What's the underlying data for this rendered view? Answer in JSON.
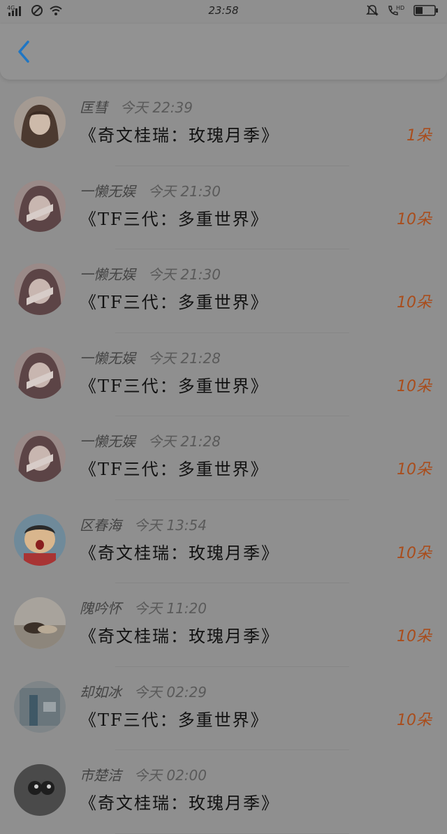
{
  "status_bar": {
    "network": "4G",
    "time": "23:58",
    "icons": [
      "signal-icon",
      "blocked-icon",
      "wifi-icon",
      "mute-icon",
      "hd-call-icon",
      "battery-icon"
    ],
    "hd_label": "HD"
  },
  "header": {
    "back_icon": "chevron-left-icon",
    "accent": "#1f76c4"
  },
  "list": [
    {
      "name": "匡彗",
      "time": "今天 22:39",
      "title": "《奇文桂瑞：玫瑰月季》",
      "count": "1朵"
    },
    {
      "name": "一懒无娱",
      "time": "今天 21:30",
      "title": "《TF三代：多重世界》",
      "count": "10朵"
    },
    {
      "name": "一懒无娱",
      "time": "今天 21:30",
      "title": "《TF三代：多重世界》",
      "count": "10朵"
    },
    {
      "name": "一懒无娱",
      "time": "今天 21:28",
      "title": "《TF三代：多重世界》",
      "count": "10朵"
    },
    {
      "name": "一懒无娱",
      "time": "今天 21:28",
      "title": "《TF三代：多重世界》",
      "count": "10朵"
    },
    {
      "name": "区春海",
      "time": "今天 13:54",
      "title": "《奇文桂瑞：玫瑰月季》",
      "count": "10朵"
    },
    {
      "name": "隗吟怀",
      "time": "今天 11:20",
      "title": "《奇文桂瑞：玫瑰月季》",
      "count": "10朵"
    },
    {
      "name": "却如冰",
      "time": "今天 02:29",
      "title": "《TF三代：多重世界》",
      "count": "10朵"
    },
    {
      "name": "市楚洁",
      "time": "今天 02:00",
      "title": "《奇文桂瑞：玫瑰月季》",
      "count": ""
    }
  ],
  "colors": {
    "count": "#a94d1c",
    "overlay_bg": "#8f8f8f"
  }
}
